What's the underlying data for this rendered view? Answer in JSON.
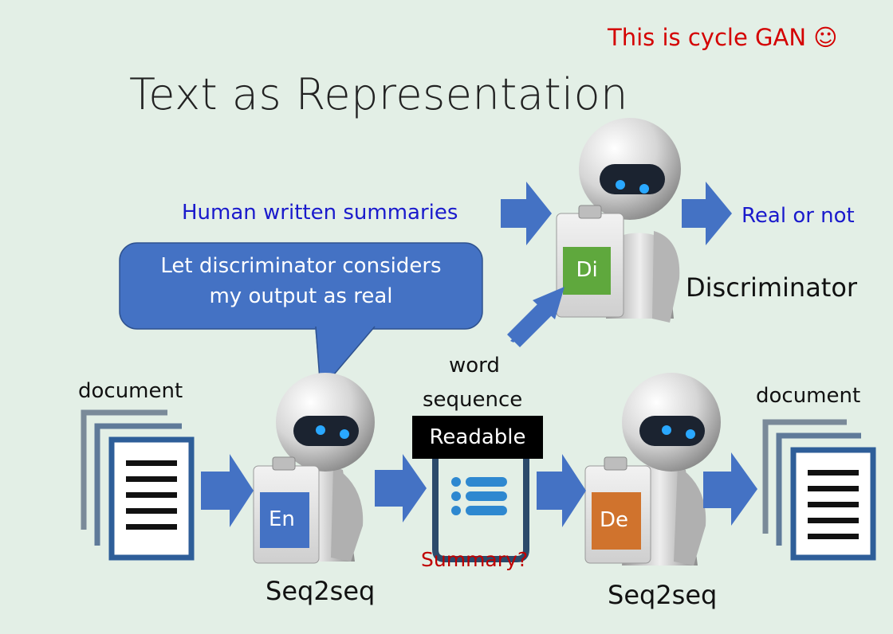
{
  "slide": {
    "title": "Text as Representation",
    "note": "This is cycle GAN ☺"
  },
  "labels": {
    "human_summaries": "Human written summaries",
    "real_or_not": "Real or not",
    "discriminator": "Discriminator",
    "document_left": "document",
    "document_right": "document",
    "word_sequence_line1": "word",
    "word_sequence_line2": "sequence",
    "readable": "Readable",
    "summary_question": "Summary?",
    "seq2seq_left": "Seq2seq",
    "seq2seq_right": "Seq2seq"
  },
  "speech_bubble": {
    "line1": "Let discriminator considers",
    "line2": "my output as real"
  },
  "tags": {
    "encoder": "En",
    "discriminator": "Di",
    "decoder": "De"
  },
  "colors": {
    "arrow": "#4472c4",
    "encoder_tag": "#4472c4",
    "discriminator_tag": "#5fa83d",
    "decoder_tag": "#d0732d",
    "bubble": "#4472c4",
    "note_red": "#d40000",
    "label_blue": "#1a1acc",
    "summary_red": "#c00000"
  },
  "icons": [
    "robot-icon",
    "document-stack-icon",
    "summary-list-icon",
    "arrow-icon",
    "clipboard-icon"
  ]
}
